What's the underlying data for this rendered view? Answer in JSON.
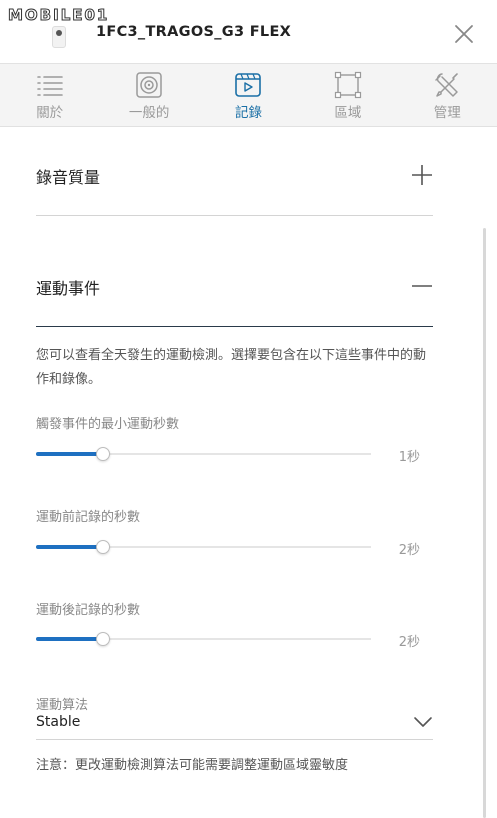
{
  "watermark": "MOBILE01",
  "header": {
    "device_name": "1FC3_TRAGOS_G3 FLEX"
  },
  "tabs": [
    {
      "label": "關於",
      "icon": "list-icon"
    },
    {
      "label": "一般的",
      "icon": "speaker-icon"
    },
    {
      "label": "記錄",
      "icon": "video-icon"
    },
    {
      "label": "區域",
      "icon": "zone-icon"
    },
    {
      "label": "管理",
      "icon": "tools-icon"
    }
  ],
  "active_tab": 2,
  "recording_quality": {
    "title": "錄音質量"
  },
  "motion_events": {
    "title": "運動事件",
    "description": "您可以查看全天發生的運動檢測。選擇要包含在以下這些事件中的動作和錄像。",
    "sliders": [
      {
        "label": "觸發事件的最小運動秒數",
        "value": "1秒",
        "level": 0.2
      },
      {
        "label": "運動前記錄的秒數",
        "value": "2秒",
        "level": 0.2
      },
      {
        "label": "運動後記錄的秒數",
        "value": "2秒",
        "level": 0.2
      }
    ],
    "algorithm": {
      "label": "運動算法",
      "value": "Stable"
    },
    "note": "注意：更改運動檢測算法可能需要調整運動區域靈敏度"
  },
  "colors": {
    "accent": "#1e70c1",
    "active_tab": "#1a6fa6",
    "tab_bar": "#f4f4f4"
  }
}
